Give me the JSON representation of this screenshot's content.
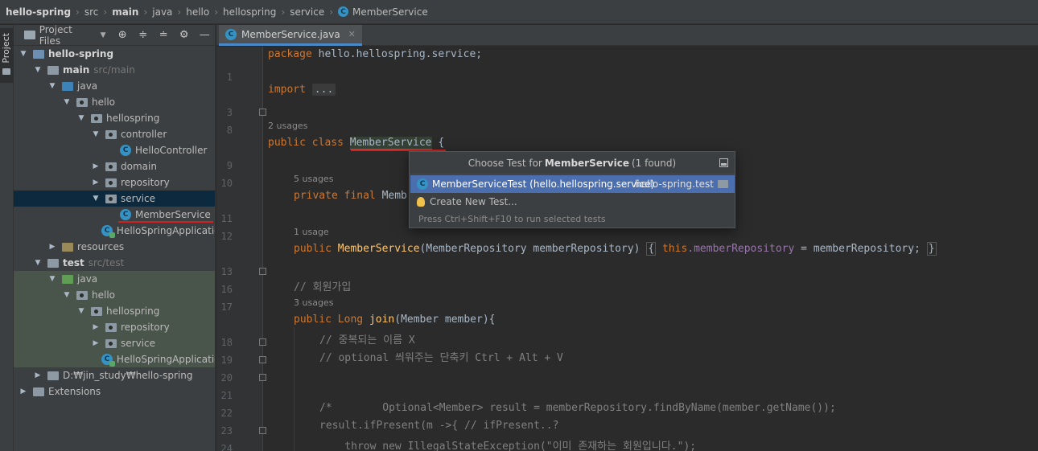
{
  "breadcrumb": [
    {
      "label": "hello-spring",
      "bold": true
    },
    {
      "label": "src",
      "bold": false
    },
    {
      "label": "main",
      "bold": true
    },
    {
      "label": "java",
      "bold": false
    },
    {
      "label": "hello",
      "bold": false
    },
    {
      "label": "hellospring",
      "bold": false
    },
    {
      "label": "service",
      "bold": false
    },
    {
      "label": "MemberService",
      "bold": false,
      "icon": "class-icon"
    }
  ],
  "toolstrip": {
    "project_tab": "Project"
  },
  "project_panel": {
    "title": "Project Files",
    "tree": [
      {
        "label": "hello-spring",
        "arrow": "open",
        "icon": "module-folder",
        "bold": true
      },
      {
        "label": "main",
        "hint": "src/main",
        "arrow": "open",
        "icon": "grey-folder",
        "bold": true
      },
      {
        "label": "java",
        "arrow": "open",
        "icon": "blue-folder"
      },
      {
        "label": "hello",
        "arrow": "open",
        "icon": "package-folder"
      },
      {
        "label": "hellospring",
        "arrow": "open",
        "icon": "package-folder"
      },
      {
        "label": "controller",
        "arrow": "open",
        "icon": "package-folder"
      },
      {
        "label": "HelloController",
        "arrow": "none",
        "icon": "class-icon"
      },
      {
        "label": "domain",
        "arrow": "closed",
        "icon": "package-folder"
      },
      {
        "label": "repository",
        "arrow": "closed",
        "icon": "package-folder"
      },
      {
        "label": "service",
        "arrow": "open",
        "icon": "package-folder"
      },
      {
        "label": "MemberService",
        "arrow": "none",
        "icon": "class-icon"
      },
      {
        "label": "HelloSpringApplicatio",
        "arrow": "none",
        "icon": "spring-class-icon"
      },
      {
        "label": "resources",
        "arrow": "closed",
        "icon": "resources-folder"
      },
      {
        "label": "test",
        "hint": "src/test",
        "arrow": "open",
        "icon": "grey-folder",
        "bold": true
      },
      {
        "label": "java",
        "arrow": "open",
        "icon": "green-folder"
      },
      {
        "label": "hello",
        "arrow": "open",
        "icon": "package-folder"
      },
      {
        "label": "hellospring",
        "arrow": "open",
        "icon": "package-folder"
      },
      {
        "label": "repository",
        "arrow": "closed",
        "icon": "package-folder"
      },
      {
        "label": "service",
        "arrow": "closed",
        "icon": "package-folder"
      },
      {
        "label": "HelloSpringApplicatio",
        "arrow": "none",
        "icon": "spring-class-icon"
      },
      {
        "label": "D:₩jin_study₩hello-spring",
        "arrow": "closed",
        "icon": "grey-folder"
      },
      {
        "label": "Extensions",
        "arrow": "closed",
        "icon": "grey-folder"
      }
    ]
  },
  "editor": {
    "tab_label": "MemberService.java",
    "line_numbers": [
      "1",
      "3",
      "8",
      "9",
      "10",
      "11",
      "12",
      "13",
      "16",
      "17",
      "18",
      "19",
      "20",
      "21",
      "22",
      "23",
      "24",
      "25"
    ],
    "hints": {
      "usages_class": "2 usages",
      "usages_field": "5 usages",
      "usages_ctor": "1 usage",
      "usages_join": "3 usages"
    },
    "code": {
      "l1_kw": "package",
      "l1_rest": " hello.hellospring.service;",
      "l3_kw": "import",
      "l3_fold": "...",
      "l9_kw": "public class ",
      "l9_name": "MemberService",
      "l9_rest": " {",
      "l11_kw": "private final ",
      "l11_rest": "Memb",
      "l13_kw": "public ",
      "l13_name": "MemberService",
      "l13_params": "(MemberRepository memberRepository) ",
      "l13_open": "{",
      "l13_this": " this",
      "l13_field": ".memberRepository",
      "l13_assign": " = memberRepository;",
      "l13_close": "}",
      "l17_comment": "// 회원가입",
      "l18_kw": "public ",
      "l18_type": "Long ",
      "l18_name": "join",
      "l18_rest": "(Member member){",
      "l19_comment": "// 중복되는 이름 X",
      "l20_comment": "// optional 씌워주는 단축키 Ctrl + Alt + V",
      "l23_comment": "/*        Optional<Member> result = memberRepository.findByName(member.getName());",
      "l24_comment": "result.ifPresent(m ->{ // ifPresent..?",
      "l25_comment": "    throw new IllegalStateException(\"이미 존재하는 회원입니다.\");"
    }
  },
  "popup": {
    "title_prefix": "Choose Test for",
    "title_class": "MemberService",
    "title_suffix": "(1 found)",
    "items": [
      {
        "label": "MemberServiceTest (hello.hellospring.service)",
        "module": "hello-spring.test",
        "selected": true
      },
      {
        "label": "Create New Test...",
        "selected": false
      }
    ],
    "footer": "Press Ctrl+Shift+F10 to run selected tests"
  },
  "colors": {
    "accent": "#4b6eaf",
    "selection": "#0d293e",
    "test_bg": "#49544a",
    "annotation_red": "#d02020"
  }
}
